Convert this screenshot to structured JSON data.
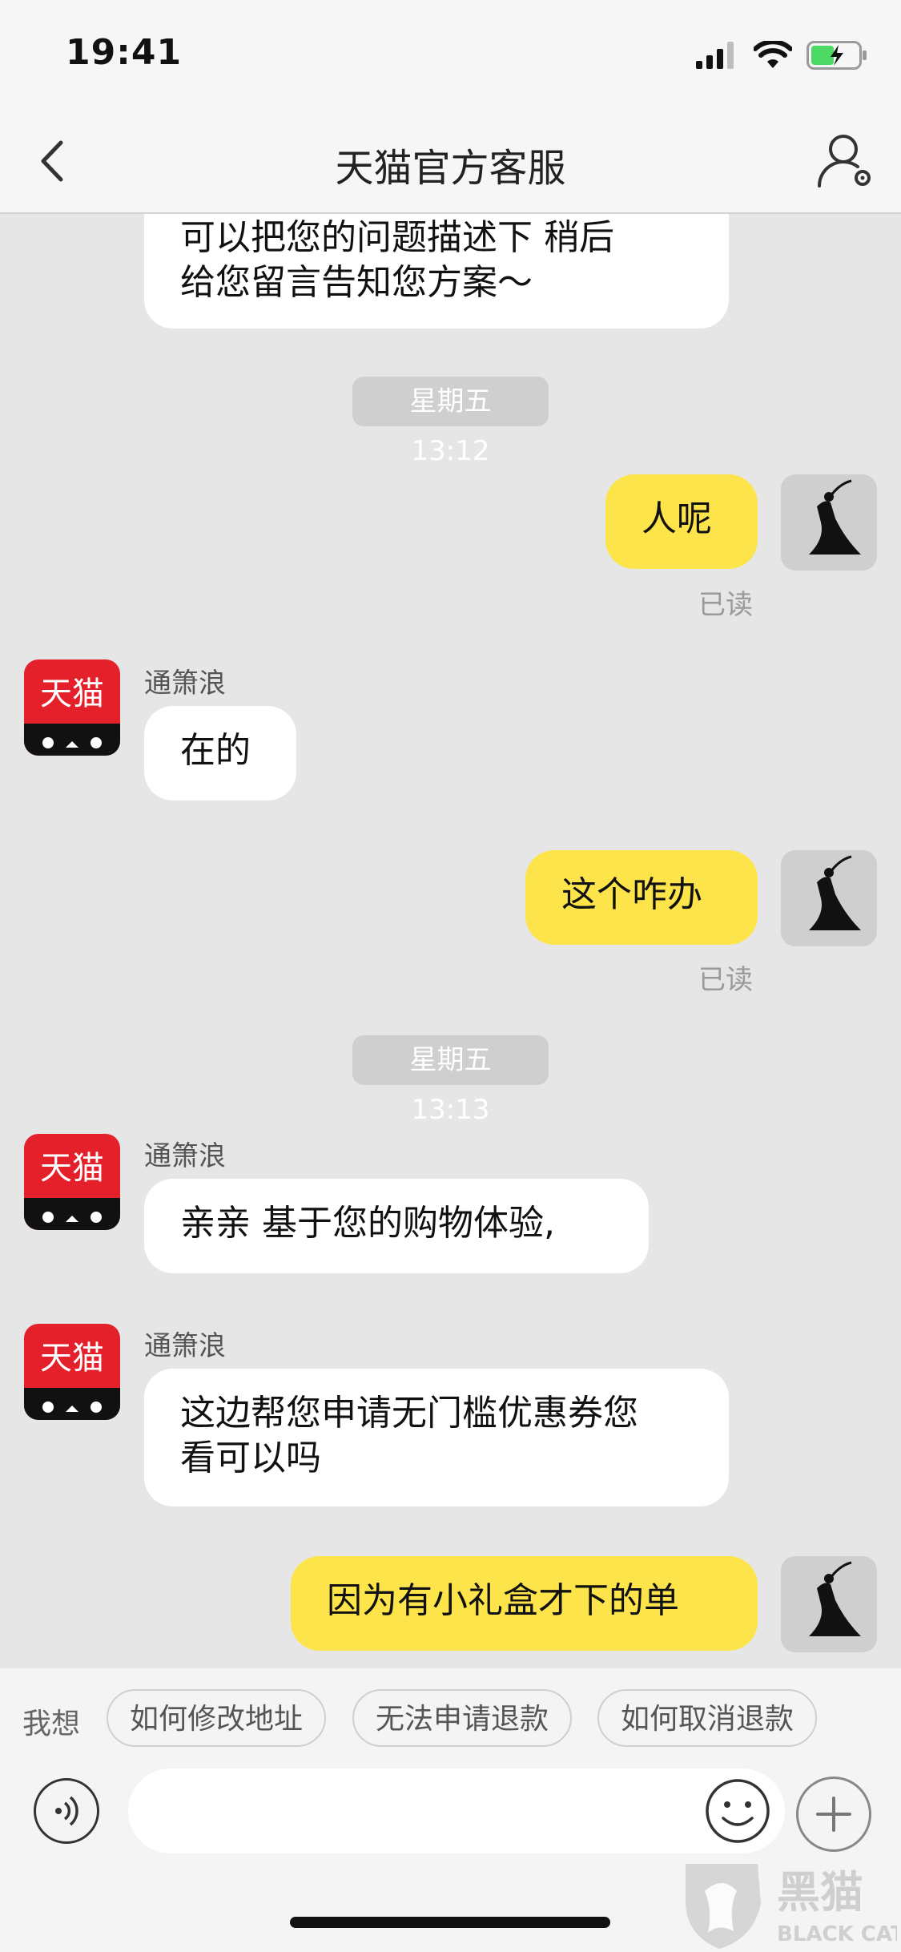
{
  "status_bar": {
    "time": "19:41"
  },
  "header": {
    "title": "天猫官方客服"
  },
  "messages": {
    "partial_top": {
      "line1": "可以把您的问题描述下 稍后",
      "line2": "给您留言告知您方案～"
    },
    "ts1": "星期五 13:12",
    "m1": "人呢",
    "read1": "已读",
    "sender2": "通箫浪",
    "m2": "在的",
    "m3": "这个咋办",
    "read2": "已读",
    "ts2": "星期五 13:13",
    "sender4": "通箫浪",
    "m4": "亲亲 基于您的购物体验,",
    "sender5": "通箫浪",
    "m5_line1": "这边帮您申请无门槛优惠券您",
    "m5_line2": "看可以吗",
    "m6": "因为有小礼盒才下的单"
  },
  "quick_replies": {
    "label": "我想",
    "items": [
      "如何修改地址",
      "无法申请退款",
      "如何取消退款"
    ]
  },
  "input": {
    "placeholder": ""
  },
  "tmall_avatar_text": "天猫",
  "watermark": {
    "main": "黑猫",
    "sub": "BLACK CAT"
  },
  "colors": {
    "user_bubble": "#fce44a",
    "agent_bubble": "#ffffff",
    "tmall_red": "#e4202b"
  }
}
